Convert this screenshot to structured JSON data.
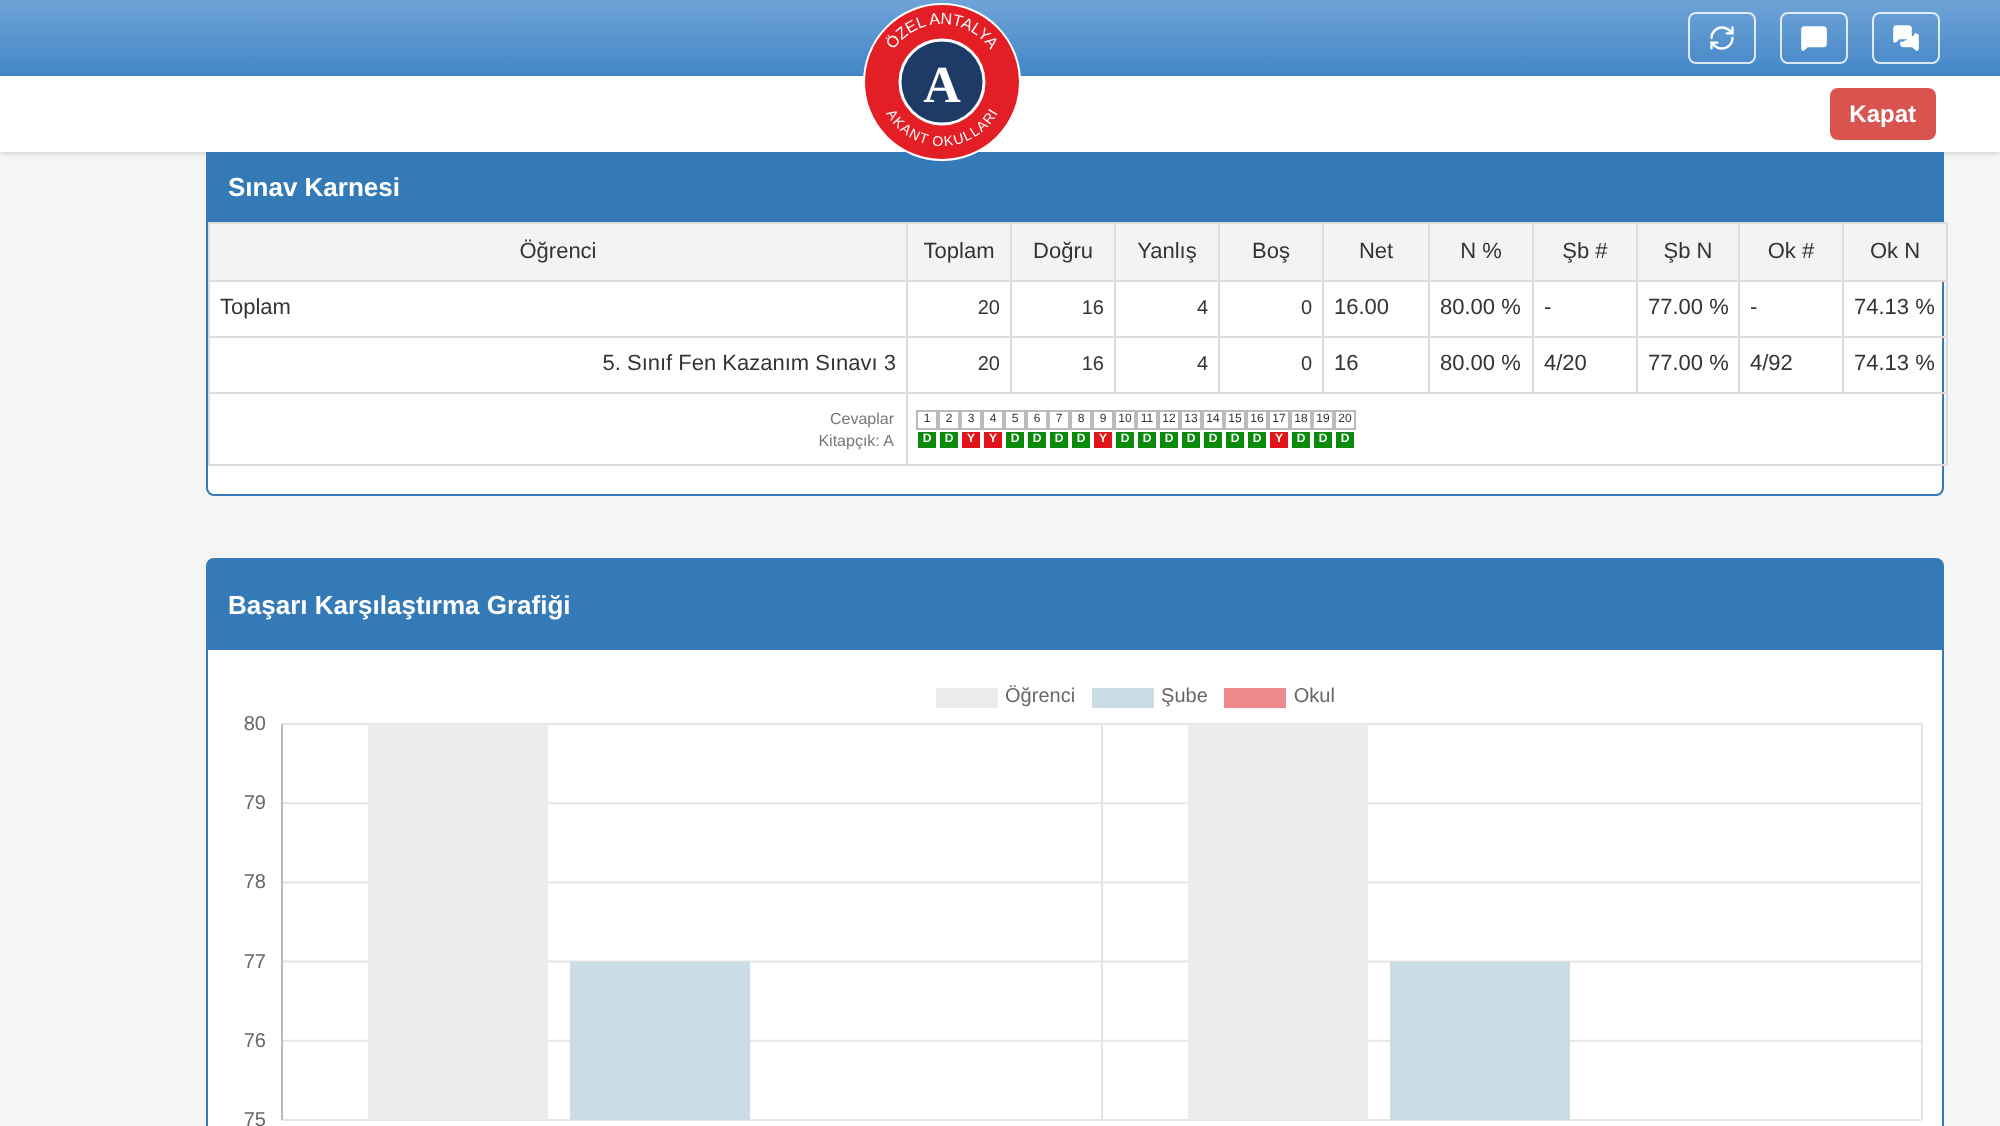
{
  "header": {
    "logo": {
      "top_text": "ÖZEL ANTALYA",
      "bottom_text": "AKANT OKULLARI",
      "letter": "A"
    },
    "close_button": "Kapat"
  },
  "report": {
    "title": "Sınav Karnesi",
    "columns": [
      "Öğrenci",
      "Toplam",
      "Doğru",
      "Yanlış",
      "Boş",
      "Net",
      "N %",
      "Şb #",
      "Şb N",
      "Ok #",
      "Ok N"
    ],
    "rows": [
      {
        "kind": "total",
        "cells": [
          "Toplam",
          "20",
          "16",
          "4",
          "0",
          "16.00",
          "80.00 %",
          "-",
          "77.00 %",
          "-",
          "74.13 %"
        ]
      },
      {
        "kind": "exam",
        "cells": [
          "5. Sınıf Fen Kazanım Sınavı 3",
          "20",
          "16",
          "4",
          "0",
          "16",
          "80.00 %",
          "4/20",
          "77.00 %",
          "4/92",
          "74.13 %"
        ]
      }
    ],
    "answers_label": "Cevaplar",
    "booklet_label": "Kitapçık: A",
    "answers": [
      {
        "number": "1",
        "answer": "D",
        "correct": true
      },
      {
        "number": "2",
        "answer": "D",
        "correct": true
      },
      {
        "number": "3",
        "answer": "Y",
        "correct": false
      },
      {
        "number": "4",
        "answer": "Y",
        "correct": false
      },
      {
        "number": "5",
        "answer": "D",
        "correct": true
      },
      {
        "number": "6",
        "answer": "D",
        "correct": true
      },
      {
        "number": "7",
        "answer": "D",
        "correct": true
      },
      {
        "number": "8",
        "answer": "D",
        "correct": true
      },
      {
        "number": "9",
        "answer": "Y",
        "correct": false
      },
      {
        "number": "10",
        "answer": "D",
        "correct": true
      },
      {
        "number": "11",
        "answer": "D",
        "correct": true
      },
      {
        "number": "12",
        "answer": "D",
        "correct": true
      },
      {
        "number": "13",
        "answer": "D",
        "correct": true
      },
      {
        "number": "14",
        "answer": "D",
        "correct": true
      },
      {
        "number": "15",
        "answer": "D",
        "correct": true
      },
      {
        "number": "16",
        "answer": "D",
        "correct": true
      },
      {
        "number": "17",
        "answer": "Y",
        "correct": false
      },
      {
        "number": "18",
        "answer": "D",
        "correct": true
      },
      {
        "number": "19",
        "answer": "D",
        "correct": true
      },
      {
        "number": "20",
        "answer": "D",
        "correct": true
      }
    ]
  },
  "comparison": {
    "title": "Başarı Karşılaştırma Grafiği",
    "chart_data": {
      "type": "bar",
      "legend": true,
      "grid": true,
      "ylim": [
        75,
        80
      ],
      "yticks": [
        75,
        76,
        77,
        78,
        79,
        80
      ],
      "series": [
        {
          "name": "Öğrenci",
          "color": "#ebebeb",
          "values": [
            80,
            80
          ]
        },
        {
          "name": "Şube",
          "color": "#c9dce6",
          "values": [
            77,
            77
          ]
        },
        {
          "name": "Okul",
          "color": "#f08a8a",
          "values": [
            null,
            null
          ]
        }
      ]
    }
  }
}
